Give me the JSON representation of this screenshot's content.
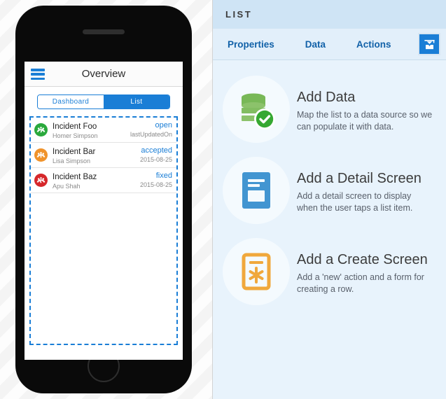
{
  "phone": {
    "navbar": {
      "menu_icon": "hamburger-icon",
      "title": "Overview"
    },
    "segmented_control": {
      "options": [
        {
          "label": "Dashboard",
          "active": false
        },
        {
          "label": "List",
          "active": true
        }
      ]
    },
    "list": [
      {
        "icon": "gauge-icon",
        "icon_color": "#2aa93c",
        "title": "Incident Foo",
        "subtitle": "Homer Simpson",
        "status": "open",
        "date": "lastUpdatedOn"
      },
      {
        "icon": "gauge-icon",
        "icon_color": "#f0932b",
        "title": "Incident Bar",
        "subtitle": "Lisa Simpson",
        "status": "accepted",
        "date": "2015-08-25"
      },
      {
        "icon": "gauge-icon",
        "icon_color": "#d6272b",
        "title": "Incident Baz",
        "subtitle": "Apu Shah",
        "status": "fixed",
        "date": "2015-08-25"
      }
    ]
  },
  "panel": {
    "title": "LIST",
    "tabs": [
      {
        "label": "Properties"
      },
      {
        "label": "Data"
      },
      {
        "label": "Actions"
      }
    ],
    "help_button": {
      "icon": "graduation-cap-icon"
    },
    "cards": [
      {
        "icon": "database-check-icon",
        "icon_color": "#78b857",
        "badge_color": "#36a832",
        "title": "Add Data",
        "description": "Map the list to a data source so we can populate it with data."
      },
      {
        "icon": "detail-screen-icon",
        "icon_color": "#4295d1",
        "title": "Add a Detail Screen",
        "description": "Add a detail screen to display when the user taps a list item."
      },
      {
        "icon": "create-screen-icon",
        "icon_color": "#f0a83c",
        "title": "Add a Create Screen",
        "description": "Add a 'new' action and a form for creating a row."
      }
    ]
  },
  "colors": {
    "accent_blue": "#1a7ed6",
    "panel_bg": "#e8f3fc",
    "panel_header_bg": "#cfe4f5",
    "tab_text": "#1161a8"
  }
}
